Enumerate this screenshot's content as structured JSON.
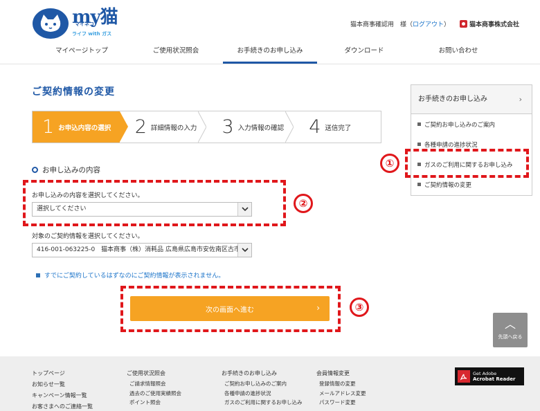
{
  "header": {
    "logo": {
      "main": "my猫",
      "sub": "マイネコ",
      "tagline": "ライフ with ガス"
    },
    "user_name": "猫本商事確認用　様",
    "logout_open": "（",
    "logout_label": "ログアウト",
    "logout_close": "）",
    "company_name": "猫本商事株式会社"
  },
  "nav": [
    "マイページトップ",
    "ご使用状況照会",
    "お手続きのお申し込み",
    "ダウンロード",
    "お問い合わせ"
  ],
  "nav_active_index": 2,
  "main": {
    "title": "ご契約情報の変更",
    "steps": [
      {
        "num": "1",
        "label": "お申込内容の選択"
      },
      {
        "num": "2",
        "label": "詳細情報の入力"
      },
      {
        "num": "3",
        "label": "入力情報の確認"
      },
      {
        "num": "4",
        "label": "送信完了"
      }
    ],
    "section_heading": "お申し込みの内容",
    "field1_label": "お申し込みの内容を選択してください。",
    "field1_value": "選択してください",
    "field2_label": "対象のご契約情報を選択してください。",
    "field2_value": "416-001-063225-0　猫本商事（株）消耗品 広島県広島市安佐南区古市",
    "note": "すでにご契約しているはずなのにご契約情報が表示されません。",
    "next_label": "次の画面へ進む",
    "next_chevron": "›"
  },
  "annotations": [
    "①",
    "②",
    "③"
  ],
  "sidebar": {
    "heading": "お手続きのお申し込み",
    "chevron": "›",
    "items": [
      "ご契約お申し込みのご案内",
      "各種申請の進捗状況",
      "ガスのご利用に関するお申し込み",
      "ご契約情報の変更"
    ]
  },
  "totop": {
    "caret": "︿",
    "label": "先頭へ戻る"
  },
  "footer": {
    "col1": [
      "トップページ",
      "お知らせ一覧",
      "キャンペーン情報一覧",
      "お客さまへのご連絡一覧"
    ],
    "col2_head": "ご使用状況照会",
    "col2": [
      "ご請求情報照会",
      "過去のご使用実績照会",
      "ポイント照会"
    ],
    "col3_head": "お手続きのお申し込み",
    "col3": [
      "ご契約お申し込みのご案内",
      "各種申請の進捗状況",
      "ガスのご利用に関するお申し込み"
    ],
    "col4_head": "会員情報変更",
    "col4": [
      "登録情報の変更",
      "メールアドレス変更",
      "パスワード変更"
    ],
    "adobe_line1": "Get Adobe",
    "adobe_line2": "Acrobat Reader"
  },
  "colors": {
    "brand_blue": "#1f58a6",
    "accent_orange": "#f6a323",
    "annotation_red": "#e0171b",
    "link_blue": "#1a73c9"
  }
}
